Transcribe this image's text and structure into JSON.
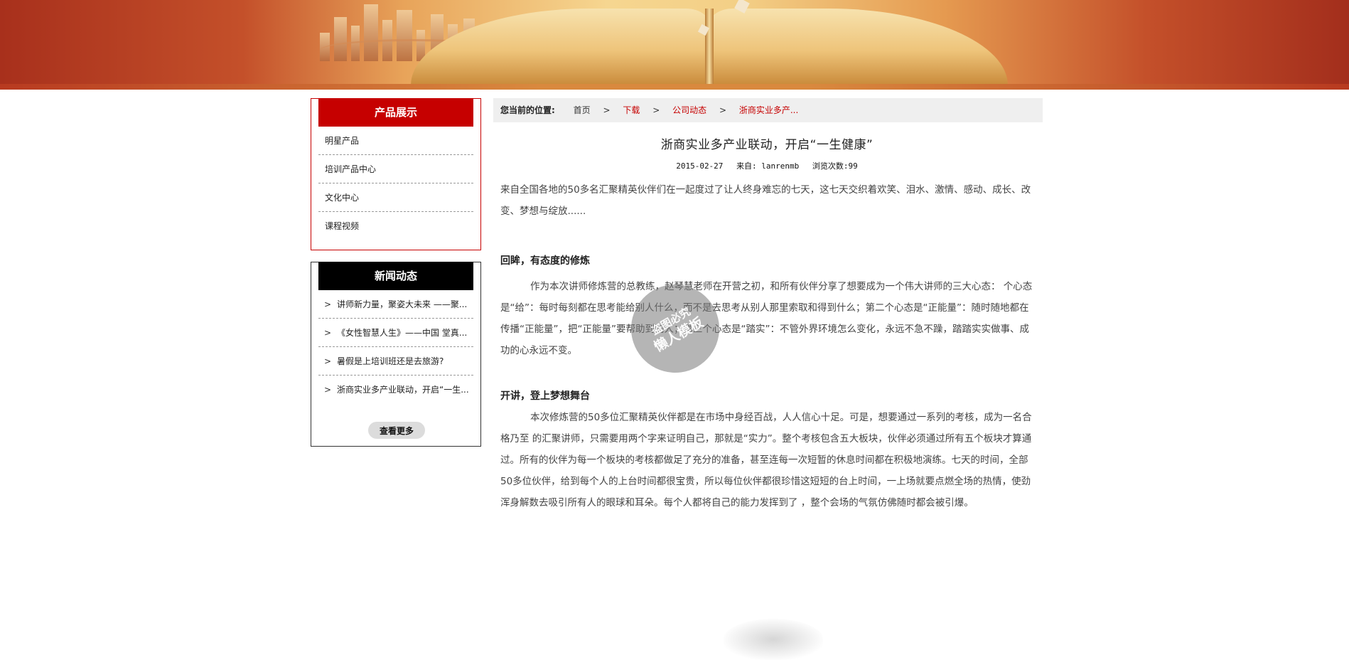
{
  "sidebar": {
    "products": {
      "title": "产品展示",
      "items": [
        "明星产品",
        "培训产品中心",
        "文化中心",
        "课程视频"
      ]
    },
    "news": {
      "title": "新闻动态",
      "items": [
        "讲师新力量，聚姿大未来 ——聚...",
        "《女性智慧人生》——中国 堂真...",
        "暑假是上培训班还是去旅游?",
        "浙商实业多产业联动，开启“一生..."
      ],
      "arrow": ">",
      "more_label": "查看更多"
    },
    "colors": {
      "products_accent": "#c60000",
      "news_accent": "#000000"
    }
  },
  "breadcrumb": {
    "label": "您当前的位置:",
    "separator": ">",
    "items": [
      "首页",
      "下载",
      "公司动态",
      "浙商实业多产..."
    ]
  },
  "article": {
    "title": "浙商实业多产业联动，开启“一生健康”",
    "date": "2015-02-27",
    "source": "来自: lanrenmb",
    "views": "浏览次数:99",
    "intro": "来自全国各地的50多名汇聚精英伙伴们在一起度过了让人终身难忘的七天，这七天交织着欢笑、泪水、激情、感动、成长、改变、梦想与绽放......",
    "sections": [
      {
        "title": "回眸，有态度的修炼",
        "text": "作为本次讲师修炼营的总教练，赵琴慧老师在开营之初，和所有伙伴分享了想要成为一个伟大讲师的三大心态： 个心态是“给”：每时每刻都在思考能给别人什么，而不是去思考从别人那里索取和得到什么；第二个心态是“正能量”：随时随地都在传播“正能量”，把“正能量”要帮助到别人；第三个心态是“踏实”：不管外界环境怎么变化，永远不急不躁，踏踏实实做事、成功的心永远不变。"
      },
      {
        "title": "开讲，登上梦想舞台",
        "text": "本次修炼营的50多位汇聚精英伙伴都是在市场中身经百战，人人信心十足。可是，想要通过一系列的考核，成为一名合格乃至 的汇聚讲师，只需要用两个字来证明自己，那就是“实力”。整个考核包含五大板块，伙伴必须通过所有五个板块才算通过。所有的伙伴为每一个板块的考核都做足了充分的准备，甚至连每一次短暂的休息时间都在积极地演练。七天的时间，全部50多位伙伴，给到每个人的上台时间都很宝贵，所以每位伙伴都很珍惜这短短的台上时间，一上场就要点燃全场的热情，使劲浑身解数去吸引所有人的眼球和耳朵。每个人都将自己的能力发挥到了 ，整个会场的气氛仿佛随时都会被引爆。"
      }
    ]
  },
  "watermark": {
    "line1": "盗图必究",
    "line2": "懒人模板"
  }
}
